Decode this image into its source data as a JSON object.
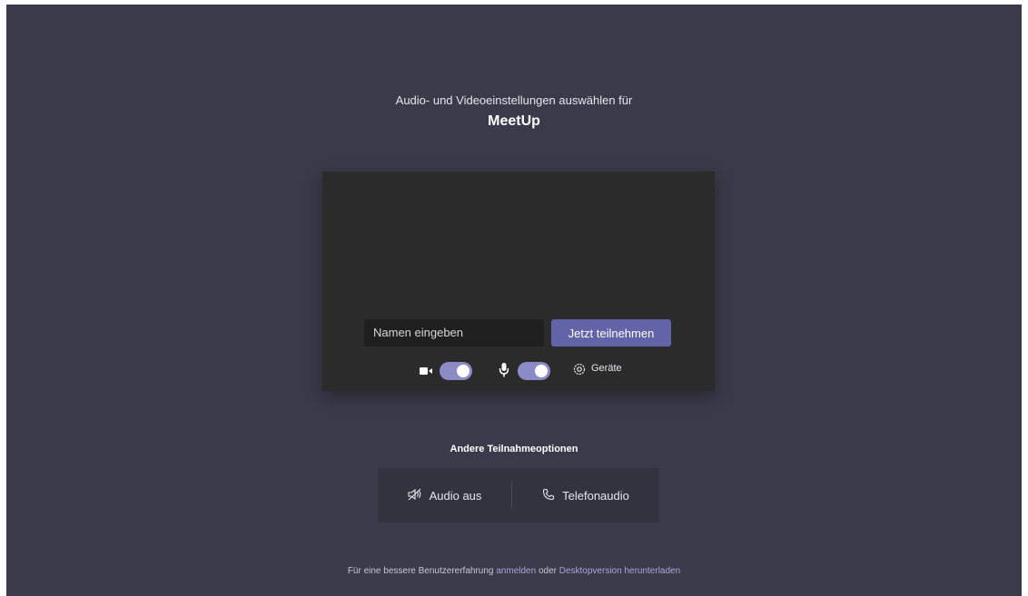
{
  "header": {
    "subtitle": "Audio- und Videoeinstellungen auswählen für",
    "meeting_name": "MeetUp"
  },
  "join_card": {
    "name_placeholder": "Namen eingeben",
    "join_label": "Jetzt teilnehmen",
    "camera_icon": "video-camera-icon",
    "camera_on": true,
    "mic_icon": "microphone-icon",
    "mic_on": true,
    "devices_icon": "gear-icon",
    "devices_label": "Geräte"
  },
  "other_options": {
    "title": "Andere Teilnahmeoptionen",
    "audio_off_icon": "speaker-muted-icon",
    "audio_off_label": "Audio aus",
    "phone_icon": "phone-icon",
    "phone_label": "Telefonaudio"
  },
  "footer": {
    "prefix": "Für eine bessere Benutzererfahrung",
    "signin_link": "anmelden",
    "middle": "oder",
    "desktop_link": "Desktopversion herunterladen"
  },
  "colors": {
    "background": "#3b3a4a",
    "card": "#2b2b2b",
    "accent": "#6264a7",
    "toggle": "#8b8cc7",
    "link": "#a6a7dc"
  }
}
